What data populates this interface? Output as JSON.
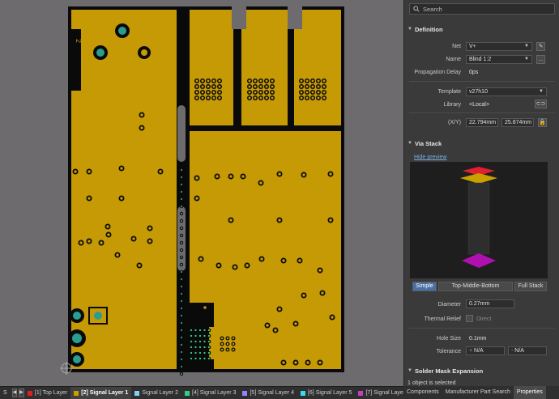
{
  "panel": {
    "search_placeholder": "Search",
    "definition_title": "Definition",
    "net_label": "Net",
    "net_value": "V+",
    "name_label": "Name",
    "name_value": "Blind 1:2",
    "prop_delay_label": "Propagation Delay",
    "prop_delay_value": "0ps",
    "template_label": "Template",
    "template_value": "v27h10",
    "library_label": "Library",
    "library_value": "<Local>",
    "xy_label": "(X/Y)",
    "x_value": "22.794mm",
    "y_value": "25.874mm",
    "via_stack_title": "Via Stack",
    "hide_preview": "Hide preview",
    "stack_modes": [
      "Simple",
      "Top-Middle-Bottom",
      "Full Stack"
    ],
    "diameter_label": "Diameter",
    "diameter_value": "0.27mm",
    "thermal_relief_label": "Thermal Relief",
    "thermal_relief_value": "Direct",
    "hole_size_label": "Hole Size",
    "hole_size_value": "0.1mm",
    "tolerance_label": "Tolerance",
    "tol_plus_value": "N/A",
    "tol_minus_value": "N/A",
    "solder_mask_title": "Solder Mask Expansion",
    "selection_status": "1 object is selected"
  },
  "layers": [
    {
      "label": "[1] Top Layer",
      "color": "#e02020"
    },
    {
      "label": "[2] Signal Layer 1",
      "color": "#c8a000",
      "active": true
    },
    {
      "label": "Signal Layer 2",
      "color": "#7fd3f0"
    },
    {
      "label": "[4] Signal Layer 3",
      "color": "#2fd08a"
    },
    {
      "label": "[5] Signal Layer 4",
      "color": "#9a80ff"
    },
    {
      "label": "[6] Signal Layer 5",
      "color": "#30e0f0"
    },
    {
      "label": "[7] Signal Laye",
      "color": "#c040c0"
    }
  ],
  "layer_prefix": "S",
  "panel_tabs": [
    "Components",
    "Manufacturer Part Search",
    "Properties"
  ],
  "board_label": "2",
  "colors": {
    "copper": "#c59a05",
    "board_edge": "#0a0a0a",
    "canvas_bg": "#6e6b6e",
    "via_pad": "#2a9d8f",
    "accent": "#4a6fa5"
  }
}
